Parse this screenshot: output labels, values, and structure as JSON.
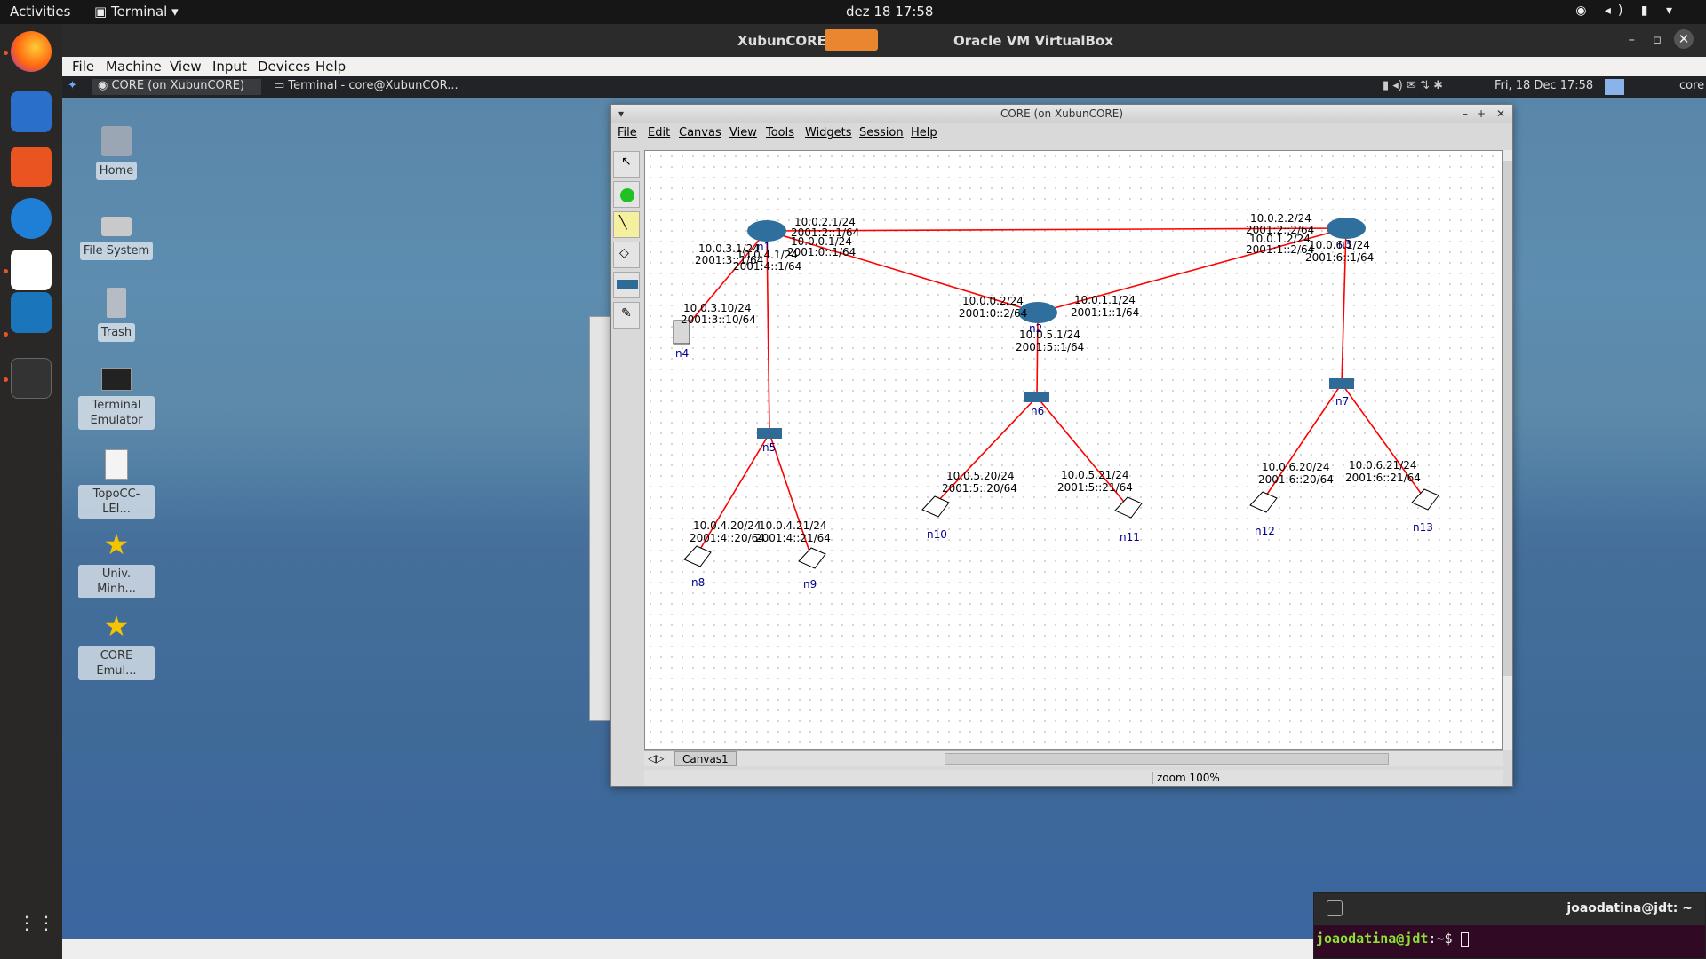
{
  "topbar": {
    "activities": "Activities",
    "app": "Terminal",
    "clock": "dez 18  17:58"
  },
  "vbox": {
    "title_left": "XubunCORE",
    "title_right": "Oracle VM VirtualBox",
    "menu": [
      "File",
      "Machine",
      "View",
      "Input",
      "Devices",
      "Help"
    ]
  },
  "xfce_panel": {
    "task1": "CORE (on XubunCORE)",
    "task2": "Terminal - core@XubunCOR...",
    "datetime": "Fri, 18 Dec  17:58",
    "user": "core"
  },
  "desktop_icons": [
    {
      "label": "Home"
    },
    {
      "label": "File System"
    },
    {
      "label": "Trash"
    },
    {
      "label": "Terminal Emulator"
    },
    {
      "label": "TopoCC-LEI..."
    },
    {
      "label": "Univ. Minh..."
    },
    {
      "label": "CORE Emul..."
    }
  ],
  "core": {
    "title": "CORE (on XubunCORE)",
    "menu": [
      "File",
      "Edit",
      "Canvas",
      "View",
      "Tools",
      "Widgets",
      "Session",
      "Help"
    ],
    "canvas_tab": "Canvas1",
    "zoom": "zoom 100%",
    "nodes": [
      {
        "id": "n1",
        "type": "router"
      },
      {
        "id": "n2",
        "type": "router"
      },
      {
        "id": "n3",
        "type": "router"
      },
      {
        "id": "n4",
        "type": "server"
      },
      {
        "id": "n5",
        "type": "switch"
      },
      {
        "id": "n6",
        "type": "switch"
      },
      {
        "id": "n7",
        "type": "switch"
      },
      {
        "id": "n8",
        "type": "laptop"
      },
      {
        "id": "n9",
        "type": "laptop"
      },
      {
        "id": "n10",
        "type": "laptop"
      },
      {
        "id": "n11",
        "type": "laptop"
      },
      {
        "id": "n12",
        "type": "laptop"
      },
      {
        "id": "n13",
        "type": "laptop"
      }
    ],
    "addresses": [
      {
        "ipv4": "10.0.2.1/24",
        "ipv6": "2001:2::1/64"
      },
      {
        "ipv4": "10.0.0.1/24",
        "ipv6": "2001:0::1/64"
      },
      {
        "ipv4": "10.0.3.1/24",
        "ipv6": "2001:3::1/64"
      },
      {
        "ipv4": "10.0.4.1/24",
        "ipv6": "2001:4::1/64"
      },
      {
        "ipv4": "10.0.3.10/24",
        "ipv6": "2001:3::10/64"
      },
      {
        "ipv4": "10.0.0.2/24",
        "ipv6": "2001:0::2/64"
      },
      {
        "ipv4": "10.0.1.1/24",
        "ipv6": "2001:1::1/64"
      },
      {
        "ipv4": "10.0.5.1/24",
        "ipv6": "2001:5::1/64"
      },
      {
        "ipv4": "10.0.2.2/24",
        "ipv6": "2001:2::2/64"
      },
      {
        "ipv4": "10.0.1.2/24",
        "ipv6": "2001:1::2/64"
      },
      {
        "ipv4": "10.0.6.1/24",
        "ipv6": "2001:6::1/64"
      },
      {
        "ipv4": "10.0.4.20/24",
        "ipv6": "2001:4::20/64"
      },
      {
        "ipv4": "10.0.4.21/24",
        "ipv6": "2001:4::21/64"
      },
      {
        "ipv4": "10.0.5.20/24",
        "ipv6": "2001:5::20/64"
      },
      {
        "ipv4": "10.0.5.21/24",
        "ipv6": "2001:5::21/64"
      },
      {
        "ipv4": "10.0.6.20/24",
        "ipv6": "2001:6::20/64"
      },
      {
        "ipv4": "10.0.6.21/24",
        "ipv6": "2001:6::21/64"
      }
    ]
  },
  "terminal": {
    "title": "joaodatina@jdt: ~",
    "user_host": "joaodatina@jdt",
    "path": ":~$"
  },
  "colors": {
    "link": "#ff0000",
    "node_label": "#00008b",
    "term_prompt": "#8ae234"
  }
}
